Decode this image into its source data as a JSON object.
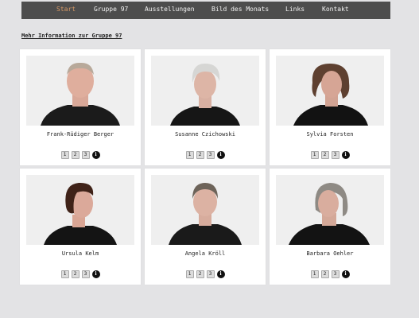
{
  "nav": {
    "items": [
      {
        "label": "Start",
        "active": true
      },
      {
        "label": "Gruppe 97",
        "active": false
      },
      {
        "label": "Ausstellungen",
        "active": false
      },
      {
        "label": "Bild des Monats",
        "active": false
      },
      {
        "label": "Links",
        "active": false
      },
      {
        "label": "Kontakt",
        "active": false
      }
    ],
    "background": "#4d4d4d",
    "active_color": "#d89a66"
  },
  "page_title": "Mehr Information zur Gruppe 97",
  "cards": [
    {
      "name": "Frank-Rüdiger Berger",
      "pages": [
        "1",
        "2",
        "3"
      ],
      "info": "i"
    },
    {
      "name": "Susanne Czichowski",
      "pages": [
        "1",
        "2",
        "3"
      ],
      "info": "i"
    },
    {
      "name": "Sylvia Forsten",
      "pages": [
        "1",
        "2",
        "3"
      ],
      "info": "i"
    },
    {
      "name": "Ursula Kelm",
      "pages": [
        "1",
        "2",
        "3"
      ],
      "info": "i"
    },
    {
      "name": "Angela Kröll",
      "pages": [
        "1",
        "2",
        "3"
      ],
      "info": "i"
    },
    {
      "name": "Barbara Oehler",
      "pages": [
        "1",
        "2",
        "3"
      ],
      "info": "i"
    }
  ]
}
